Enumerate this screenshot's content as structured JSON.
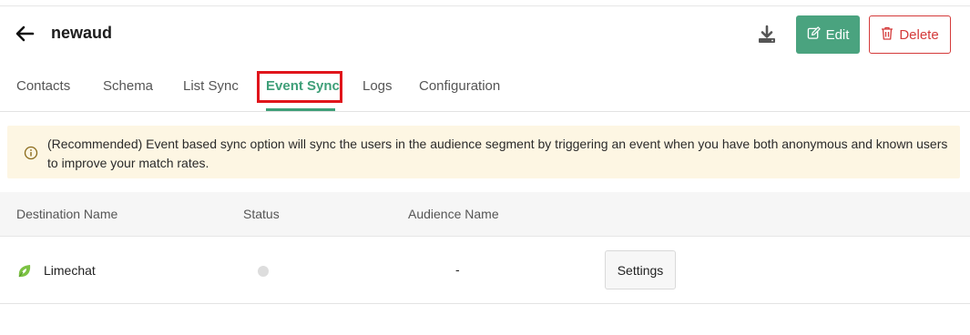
{
  "header": {
    "title": "newaud",
    "edit_label": "Edit",
    "delete_label": "Delete"
  },
  "tabs": [
    {
      "label": "Contacts",
      "active": false
    },
    {
      "label": "Schema",
      "active": false
    },
    {
      "label": "List Sync",
      "active": false
    },
    {
      "label": "Event Sync",
      "active": true
    },
    {
      "label": "Logs",
      "active": false
    },
    {
      "label": "Configuration",
      "active": false
    }
  ],
  "banner": {
    "text": "(Recommended) Event based sync option will sync the users in the audience segment by triggering an event when you have both anonymous and known users to improve your match rates."
  },
  "table": {
    "columns": [
      "Destination Name",
      "Status",
      "Audience Name"
    ],
    "rows": [
      {
        "destination": "Limechat",
        "destination_icon": "limechat-leaf-icon",
        "status": "inactive",
        "audience_name": "-",
        "action_label": "Settings"
      }
    ]
  },
  "colors": {
    "accent": "#3f9f78",
    "edit_button": "#4aa37f",
    "danger": "#d43a3a",
    "highlight_box": "#e0151b",
    "banner_bg": "#fdf6e3"
  }
}
